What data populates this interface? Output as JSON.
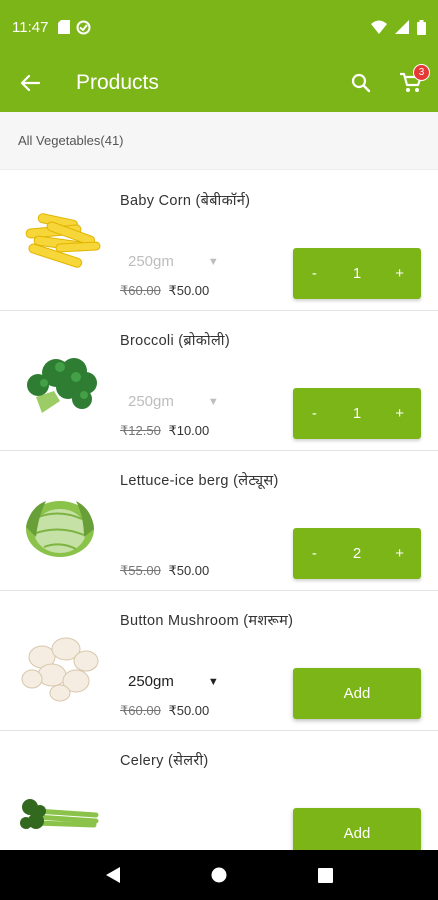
{
  "status_bar": {
    "time": "11:47"
  },
  "app_bar": {
    "title": "Products",
    "cart_count": "3"
  },
  "category": {
    "label": "All Vegetables(41)"
  },
  "products": [
    {
      "name": "Baby Corn  (बेबीकॉर्न)",
      "variant": "250gm",
      "mrp": "₹60.00",
      "price": "₹50.00",
      "qty": "1",
      "minus": "-",
      "plus": "+"
    },
    {
      "name": "Broccoli  (ब्रोकोली)",
      "variant": "250gm",
      "mrp": "₹12.50",
      "price": "₹10.00",
      "qty": "1",
      "minus": "-",
      "plus": "+"
    },
    {
      "name": "Lettuce-ice berg  (लेट्यूस)",
      "mrp": "₹55.00",
      "price": "₹50.00",
      "qty": "2",
      "minus": "-",
      "plus": "+"
    },
    {
      "name": "Button Mushroom  (मशरूम)",
      "variant": "250gm",
      "mrp": "₹60.00",
      "price": "₹50.00",
      "add_label": "Add"
    },
    {
      "name": "Celery (सेलरी)",
      "add_label": "Add"
    }
  ]
}
